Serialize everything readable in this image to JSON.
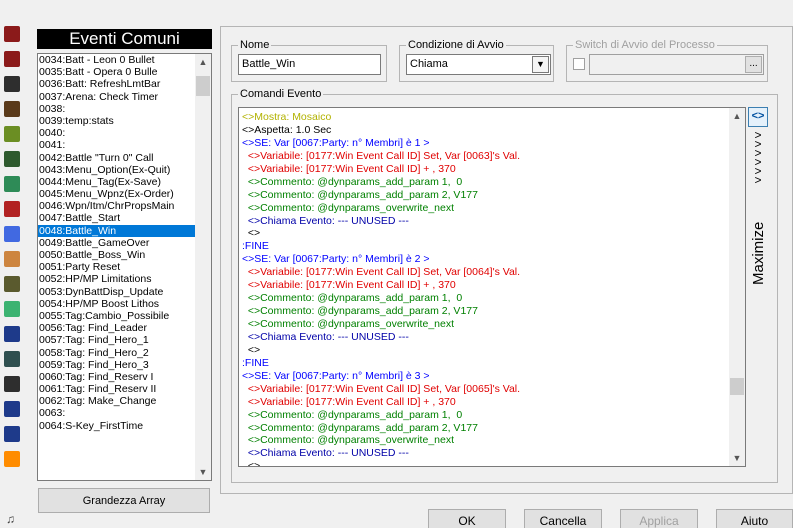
{
  "toolbar": {
    "icons": [
      "map-tool-icon",
      "event-tool-icon",
      "edit-tool-icon",
      "pencil-tool-icon",
      "character-tool-icon",
      "monster-tool-icon",
      "skills-tool-icon",
      "items-tool-icon",
      "battle-tool-icon",
      "terrain-tool-icon",
      "hero-tool-icon",
      "tileset-tool-icon",
      "system-tool-icon",
      "text-tool-icon",
      "test-play-tool-icon",
      "number-1-icon",
      "number-2-icon",
      "cube-tool-icon"
    ],
    "colors": [
      "#8b1a1a",
      "#8b1a1a",
      "#2e2e2e",
      "#5a3a1a",
      "#6b8e23",
      "#2e5a2e",
      "#2e8b57",
      "#b22222",
      "#4169e1",
      "#cd853f",
      "#5a5a2e",
      "#3cb371",
      "#1e3a8a",
      "#2f4f4f",
      "#2e2e2e",
      "#1e3a8a",
      "#1e3a8a",
      "#ff8c00"
    ]
  },
  "list": {
    "title": "Eventi Comuni",
    "items": [
      "0034:Batt - Leon 0 Bullet",
      "0035:Batt - Opera 0 Bulle",
      "0036:Batt: RefreshLmtBar",
      "0037:Arena: Check Timer",
      "0038:",
      "0039:temp:stats",
      "0040:",
      "0041:",
      "0042:Battle \"Turn 0\" Call",
      "0043:Menu_Option(Ex-Quit)",
      "0044:Menu_Tag(Ex-Save)",
      "0045:Menu_Wpnz(Ex-Order)",
      "0046:Wpn/Itm/ChrPropsMain",
      "0047:Battle_Start",
      "0048:Battle_Win",
      "0049:Battle_GameOver",
      "0050:Battle_Boss_Win",
      "0051:Party Reset",
      "0052:HP/MP Limitations",
      "0053:DynBattDisp_Update",
      "0054:HP/MP Boost Lithos",
      "0055:Tag:Cambio_Possibile",
      "0056:Tag: Find_Leader",
      "0057:Tag: Find_Hero_1",
      "0058:Tag: Find_Hero_2",
      "0059:Tag: Find_Hero_3",
      "0060:Tag: Find_Reserv I",
      "0061:Tag: Find_Reserv II",
      "0062:Tag: Make_Change",
      "0063:",
      "0064:S-Key_FirstTime"
    ],
    "selected_index": 14,
    "array_button": "Grandezza Array"
  },
  "form": {
    "name_label": "Nome",
    "name_value": "Battle_Win",
    "condition_label": "Condizione di Avvio",
    "condition_value": "Chiama",
    "switch_label": "Switch di Avvio del Processo",
    "switch_button": "..."
  },
  "commands": {
    "label": "Comandi Evento",
    "lines": [
      {
        "text": "<>Mostra: Mosaico",
        "color": "olive"
      },
      {
        "text": "<>Aspetta: 1.0 Sec",
        "color": "black"
      },
      {
        "text": "<>SE: Var [0067:Party: n° Membri] è 1 >",
        "color": "blue"
      },
      {
        "text": "  <>Variabile: [0177:Win Event Call ID] Set, Var [0063]'s Val.",
        "color": "red"
      },
      {
        "text": "  <>Variabile: [0177:Win Event Call ID] + , 370",
        "color": "red"
      },
      {
        "text": "  <>Commento: @dynparams_add_param 1,  0",
        "color": "green"
      },
      {
        "text": "  <>Commento: @dynparams_add_param 2, V177",
        "color": "green"
      },
      {
        "text": "  <>Commento: @dynparams_overwrite_next",
        "color": "green"
      },
      {
        "text": "  <>Chiama Evento: --- UNUSED ---",
        "color": "darkblue"
      },
      {
        "text": "  <>",
        "color": "black"
      },
      {
        "text": ":FINE",
        "color": "blue"
      },
      {
        "text": "<>SE: Var [0067:Party: n° Membri] è 2 >",
        "color": "blue"
      },
      {
        "text": "  <>Variabile: [0177:Win Event Call ID] Set, Var [0064]'s Val.",
        "color": "red"
      },
      {
        "text": "  <>Variabile: [0177:Win Event Call ID] + , 370",
        "color": "red"
      },
      {
        "text": "  <>Commento: @dynparams_add_param 1,  0",
        "color": "green"
      },
      {
        "text": "  <>Commento: @dynparams_add_param 2, V177",
        "color": "green"
      },
      {
        "text": "  <>Commento: @dynparams_overwrite_next",
        "color": "green"
      },
      {
        "text": "  <>Chiama Evento: --- UNUSED ---",
        "color": "darkblue"
      },
      {
        "text": "  <>",
        "color": "black"
      },
      {
        "text": ":FINE",
        "color": "blue"
      },
      {
        "text": "<>SE: Var [0067:Party: n° Membri] è 3 >",
        "color": "blue"
      },
      {
        "text": "  <>Variabile: [0177:Win Event Call ID] Set, Var [0065]'s Val.",
        "color": "red"
      },
      {
        "text": "  <>Variabile: [0177:Win Event Call ID] + , 370",
        "color": "red"
      },
      {
        "text": "  <>Commento: @dynparams_add_param 1,  0",
        "color": "green"
      },
      {
        "text": "  <>Commento: @dynparams_add_param 2, V177",
        "color": "green"
      },
      {
        "text": "  <>Commento: @dynparams_overwrite_next",
        "color": "green"
      },
      {
        "text": "  <>Chiama Evento: --- UNUSED ---",
        "color": "darkblue"
      },
      {
        "text": "  <>",
        "color": "black"
      }
    ]
  },
  "maximize": {
    "button_glyph": "<>",
    "chevrons": ">\n>\n>\n>\n>\n>",
    "label": "Maximize"
  },
  "buttons": {
    "ok": "OK",
    "cancel": "Cancella",
    "apply": "Applica",
    "help": "Aiuto"
  },
  "status_icon": "music-note-icon"
}
